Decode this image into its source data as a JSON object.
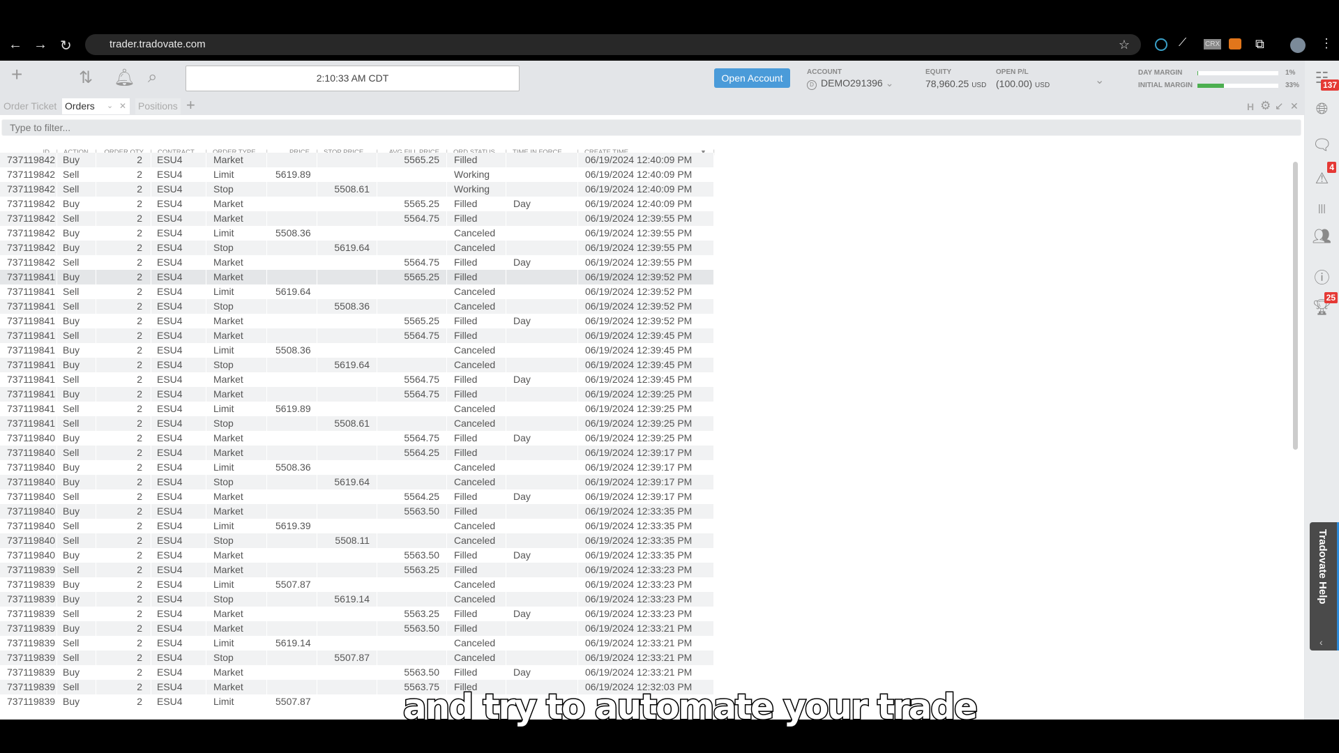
{
  "browser": {
    "url": "trader.tradovate.com",
    "extensions": [
      "vpn-icon",
      "broom-icon",
      "CRX",
      "metamask-icon",
      "puzzle-icon"
    ]
  },
  "toolbar": {
    "clock": "2:10:33 AM CDT",
    "open_account": "Open Account"
  },
  "account": {
    "label": "ACCOUNT",
    "value": "DEMO291396"
  },
  "equity": {
    "label": "EQUITY",
    "value": "78,960.25",
    "unit": "USD"
  },
  "open_pl": {
    "label": "OPEN P/L",
    "value": "(100.00)",
    "unit": "USD"
  },
  "margins": [
    {
      "label": "DAY MARGIN",
      "pct_text": "1%",
      "fraction": 0.01
    },
    {
      "label": "INITIAL MARGIN",
      "pct_text": "33%",
      "fraction": 0.33
    }
  ],
  "tabs": [
    {
      "label": "Order Ticket"
    },
    {
      "label": "Orders",
      "active": true
    },
    {
      "label": "Positions"
    }
  ],
  "panel_controls": {
    "h": "H"
  },
  "filter": {
    "placeholder": "Type to filter..."
  },
  "sidebar": {
    "badges": {
      "globe": "137",
      "alerts": "4",
      "trophy": "25"
    }
  },
  "help": {
    "label": "Tradovate Help"
  },
  "orders": {
    "columns": [
      "ID",
      "ACTION",
      "ORDER QTY",
      "CONTRACT",
      "ORDER TYPE",
      "PRICE",
      "STOP PRICE",
      "AVG FILL PRICE",
      "ORD STATUS",
      "TIME IN FORCE",
      "CREATE TIME"
    ],
    "rows": [
      [
        "737119842",
        "Buy",
        "2",
        "ESU4",
        "Market",
        "",
        "",
        "5565.25",
        "Filled",
        "",
        "06/19/2024 12:40:09 PM"
      ],
      [
        "737119842",
        "Sell",
        "2",
        "ESU4",
        "Limit",
        "5619.89",
        "",
        "",
        "Working",
        "",
        "06/19/2024 12:40:09 PM"
      ],
      [
        "737119842",
        "Sell",
        "2",
        "ESU4",
        "Stop",
        "",
        "5508.61",
        "",
        "Working",
        "",
        "06/19/2024 12:40:09 PM"
      ],
      [
        "737119842",
        "Buy",
        "2",
        "ESU4",
        "Market",
        "",
        "",
        "5565.25",
        "Filled",
        "Day",
        "06/19/2024 12:40:09 PM"
      ],
      [
        "737119842",
        "Sell",
        "2",
        "ESU4",
        "Market",
        "",
        "",
        "5564.75",
        "Filled",
        "",
        "06/19/2024 12:39:55 PM"
      ],
      [
        "737119842",
        "Buy",
        "2",
        "ESU4",
        "Limit",
        "5508.36",
        "",
        "",
        "Canceled",
        "",
        "06/19/2024 12:39:55 PM"
      ],
      [
        "737119842",
        "Buy",
        "2",
        "ESU4",
        "Stop",
        "",
        "5619.64",
        "",
        "Canceled",
        "",
        "06/19/2024 12:39:55 PM"
      ],
      [
        "737119842",
        "Sell",
        "2",
        "ESU4",
        "Market",
        "",
        "",
        "5564.75",
        "Filled",
        "Day",
        "06/19/2024 12:39:55 PM"
      ],
      [
        "737119841",
        "Buy",
        "2",
        "ESU4",
        "Market",
        "",
        "",
        "5565.25",
        "Filled",
        "",
        "06/19/2024 12:39:52 PM"
      ],
      [
        "737119841",
        "Sell",
        "2",
        "ESU4",
        "Limit",
        "5619.64",
        "",
        "",
        "Canceled",
        "",
        "06/19/2024 12:39:52 PM"
      ],
      [
        "737119841",
        "Sell",
        "2",
        "ESU4",
        "Stop",
        "",
        "5508.36",
        "",
        "Canceled",
        "",
        "06/19/2024 12:39:52 PM"
      ],
      [
        "737119841",
        "Buy",
        "2",
        "ESU4",
        "Market",
        "",
        "",
        "5565.25",
        "Filled",
        "Day",
        "06/19/2024 12:39:52 PM"
      ],
      [
        "737119841",
        "Sell",
        "2",
        "ESU4",
        "Market",
        "",
        "",
        "5564.75",
        "Filled",
        "",
        "06/19/2024 12:39:45 PM"
      ],
      [
        "737119841",
        "Buy",
        "2",
        "ESU4",
        "Limit",
        "5508.36",
        "",
        "",
        "Canceled",
        "",
        "06/19/2024 12:39:45 PM"
      ],
      [
        "737119841",
        "Buy",
        "2",
        "ESU4",
        "Stop",
        "",
        "5619.64",
        "",
        "Canceled",
        "",
        "06/19/2024 12:39:45 PM"
      ],
      [
        "737119841",
        "Sell",
        "2",
        "ESU4",
        "Market",
        "",
        "",
        "5564.75",
        "Filled",
        "Day",
        "06/19/2024 12:39:45 PM"
      ],
      [
        "737119841",
        "Buy",
        "2",
        "ESU4",
        "Market",
        "",
        "",
        "5564.75",
        "Filled",
        "",
        "06/19/2024 12:39:25 PM"
      ],
      [
        "737119841",
        "Sell",
        "2",
        "ESU4",
        "Limit",
        "5619.89",
        "",
        "",
        "Canceled",
        "",
        "06/19/2024 12:39:25 PM"
      ],
      [
        "737119841",
        "Sell",
        "2",
        "ESU4",
        "Stop",
        "",
        "5508.61",
        "",
        "Canceled",
        "",
        "06/19/2024 12:39:25 PM"
      ],
      [
        "737119840",
        "Buy",
        "2",
        "ESU4",
        "Market",
        "",
        "",
        "5564.75",
        "Filled",
        "Day",
        "06/19/2024 12:39:25 PM"
      ],
      [
        "737119840",
        "Sell",
        "2",
        "ESU4",
        "Market",
        "",
        "",
        "5564.25",
        "Filled",
        "",
        "06/19/2024 12:39:17 PM"
      ],
      [
        "737119840",
        "Buy",
        "2",
        "ESU4",
        "Limit",
        "5508.36",
        "",
        "",
        "Canceled",
        "",
        "06/19/2024 12:39:17 PM"
      ],
      [
        "737119840",
        "Buy",
        "2",
        "ESU4",
        "Stop",
        "",
        "5619.64",
        "",
        "Canceled",
        "",
        "06/19/2024 12:39:17 PM"
      ],
      [
        "737119840",
        "Sell",
        "2",
        "ESU4",
        "Market",
        "",
        "",
        "5564.25",
        "Filled",
        "Day",
        "06/19/2024 12:39:17 PM"
      ],
      [
        "737119840",
        "Buy",
        "2",
        "ESU4",
        "Market",
        "",
        "",
        "5563.50",
        "Filled",
        "",
        "06/19/2024 12:33:35 PM"
      ],
      [
        "737119840",
        "Sell",
        "2",
        "ESU4",
        "Limit",
        "5619.39",
        "",
        "",
        "Canceled",
        "",
        "06/19/2024 12:33:35 PM"
      ],
      [
        "737119840",
        "Sell",
        "2",
        "ESU4",
        "Stop",
        "",
        "5508.11",
        "",
        "Canceled",
        "",
        "06/19/2024 12:33:35 PM"
      ],
      [
        "737119840",
        "Buy",
        "2",
        "ESU4",
        "Market",
        "",
        "",
        "5563.50",
        "Filled",
        "Day",
        "06/19/2024 12:33:35 PM"
      ],
      [
        "737119839",
        "Sell",
        "2",
        "ESU4",
        "Market",
        "",
        "",
        "5563.25",
        "Filled",
        "",
        "06/19/2024 12:33:23 PM"
      ],
      [
        "737119839",
        "Buy",
        "2",
        "ESU4",
        "Limit",
        "5507.87",
        "",
        "",
        "Canceled",
        "",
        "06/19/2024 12:33:23 PM"
      ],
      [
        "737119839",
        "Buy",
        "2",
        "ESU4",
        "Stop",
        "",
        "5619.14",
        "",
        "Canceled",
        "",
        "06/19/2024 12:33:23 PM"
      ],
      [
        "737119839",
        "Sell",
        "2",
        "ESU4",
        "Market",
        "",
        "",
        "5563.25",
        "Filled",
        "Day",
        "06/19/2024 12:33:23 PM"
      ],
      [
        "737119839",
        "Buy",
        "2",
        "ESU4",
        "Market",
        "",
        "",
        "5563.50",
        "Filled",
        "",
        "06/19/2024 12:33:21 PM"
      ],
      [
        "737119839",
        "Sell",
        "2",
        "ESU4",
        "Limit",
        "5619.14",
        "",
        "",
        "Canceled",
        "",
        "06/19/2024 12:33:21 PM"
      ],
      [
        "737119839",
        "Sell",
        "2",
        "ESU4",
        "Stop",
        "",
        "5507.87",
        "",
        "Canceled",
        "",
        "06/19/2024 12:33:21 PM"
      ],
      [
        "737119839",
        "Buy",
        "2",
        "ESU4",
        "Market",
        "",
        "",
        "5563.50",
        "Filled",
        "Day",
        "06/19/2024 12:33:21 PM"
      ],
      [
        "737119839",
        "Sell",
        "2",
        "ESU4",
        "Market",
        "",
        "",
        "5563.75",
        "Filled",
        "",
        "06/19/2024 12:32:03 PM"
      ],
      [
        "737119839",
        "Buy",
        "2",
        "ESU4",
        "Limit",
        "5507.87",
        "",
        "",
        "",
        "",
        ""
      ]
    ]
  },
  "caption": "and try to automate your trade",
  "colors": {
    "accent": "#4a9bd9",
    "badge": "#e53935",
    "margin_bar": "#4caf50"
  }
}
